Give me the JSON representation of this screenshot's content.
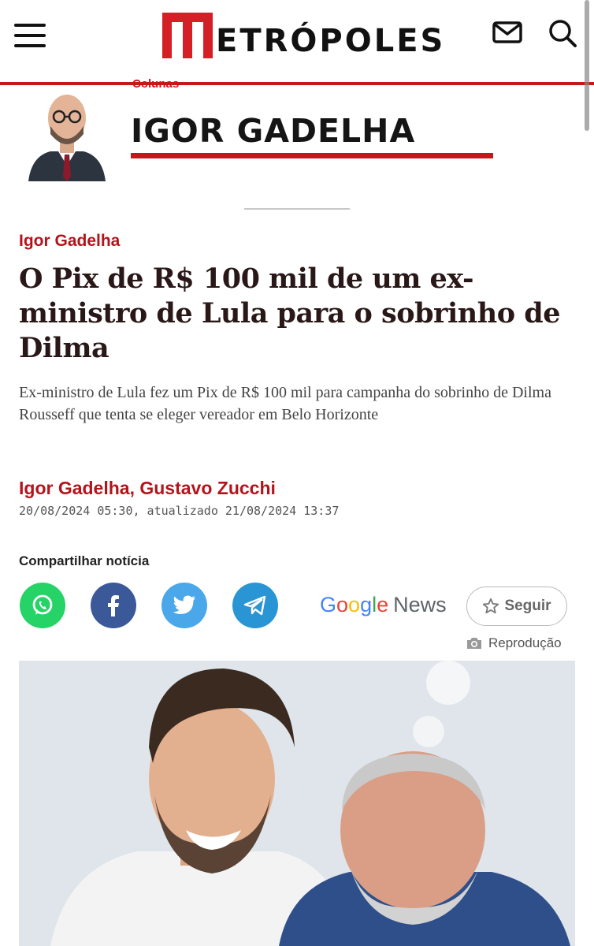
{
  "header": {
    "logo_m": "M",
    "logo_rest": "ETRÓPOLES",
    "brand_color": "#d51f26"
  },
  "column": {
    "section_label": "Colunas",
    "columnist_name": "IGOR GADELHA"
  },
  "article": {
    "kicker": "Igor Gadelha",
    "headline": "O Pix de R$ 100 mil de um ex-ministro de Lula para o sobrinho de Dilma",
    "subtitle": "Ex-ministro de Lula fez um Pix de R$ 100 mil para campanha do sobrinho de Dilma Rousseff que tenta se eleger vereador em Belo Horizonte",
    "authors": "Igor Gadelha, Gustavo Zucchi",
    "dateline": "20/08/2024 05:30, atualizado 21/08/2024 13:37"
  },
  "share": {
    "label": "Compartilhar notícia",
    "buttons": [
      "whatsapp-icon",
      "facebook-icon",
      "twitter-icon",
      "telegram-icon"
    ]
  },
  "google_news": {
    "google_letters": [
      "G",
      "o",
      "o",
      "g",
      "l",
      "e"
    ],
    "google_colors": [
      "#4285f4",
      "#ea4335",
      "#fbbc05",
      "#4285f4",
      "#34a853",
      "#ea4335"
    ],
    "news_label": "News",
    "follow_label": "Seguir"
  },
  "photo": {
    "credit": "Reprodução"
  }
}
